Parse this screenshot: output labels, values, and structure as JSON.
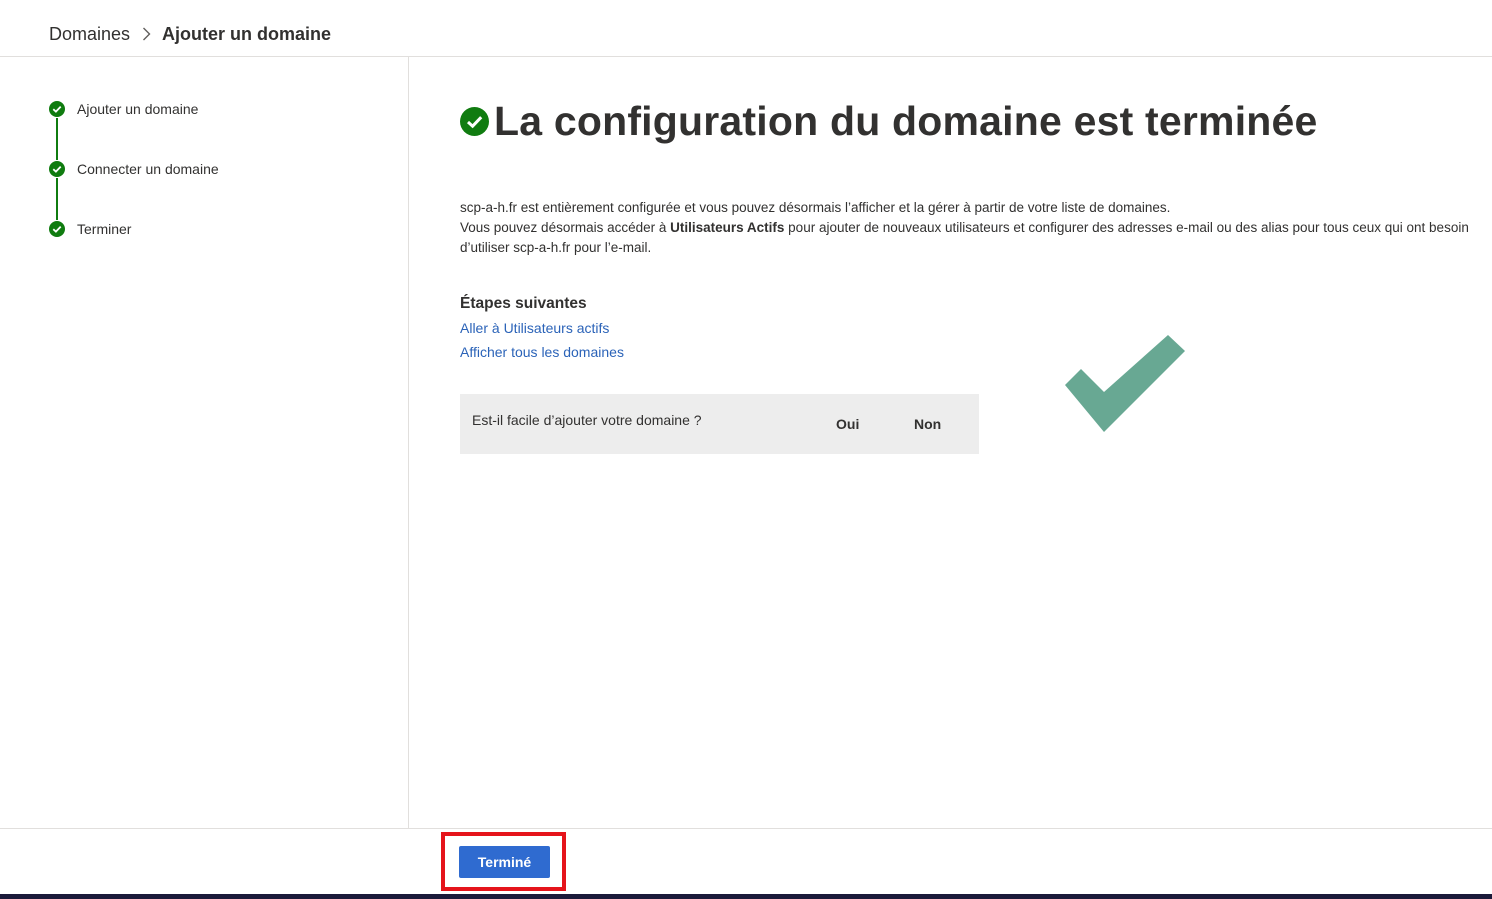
{
  "breadcrumb": {
    "parent": "Domaines",
    "current": "Ajouter un domaine"
  },
  "stepper": {
    "steps": [
      {
        "label": "Ajouter un domaine",
        "status": "complete"
      },
      {
        "label": "Connecter un domaine",
        "status": "complete"
      },
      {
        "label": "Terminer",
        "status": "complete"
      }
    ]
  },
  "main": {
    "title": "La configuration du domaine est terminée",
    "description": {
      "line1": "scp-a-h.fr est entièrement configurée et vous pouvez désormais l’afficher et la gérer à partir de votre liste de domaines.",
      "line2_prefix": "Vous pouvez désormais accéder à ",
      "line2_bold": "Utilisateurs Actifs",
      "line2_suffix": " pour ajouter de nouveaux utilisateurs et configurer des adresses e-mail ou des alias pour tous ceux qui ont besoin",
      "line3": "d’utiliser scp-a-h.fr pour l’e-mail."
    },
    "next_steps": {
      "title": "Étapes suivantes",
      "links": [
        "Aller à Utilisateurs actifs",
        "Afficher tous les domaines"
      ]
    },
    "feedback": {
      "question": "Est-il facile d’ajouter votre domaine ?",
      "yes": "Oui",
      "no": "Non"
    }
  },
  "footer": {
    "done_label": "Terminé"
  },
  "colors": {
    "success_green": "#107c10",
    "link_blue": "#2b63b8",
    "primary_button": "#2f6bd0",
    "highlight_red": "#e5141b",
    "big_check": "#68a893"
  },
  "icons": {
    "breadcrumb_separator": "chevron-right-icon",
    "step_status": "check-circle-icon",
    "title_status": "check-circle-icon",
    "decoration": "checkmark-icon"
  }
}
